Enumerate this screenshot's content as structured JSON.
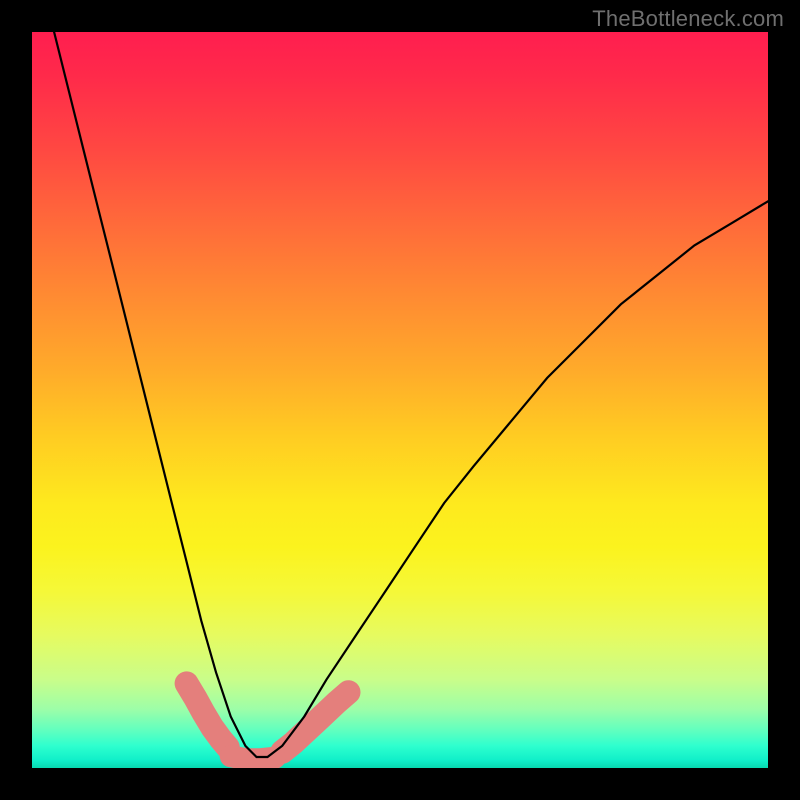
{
  "watermark": "TheBottleneck.com",
  "colors": {
    "frame": "#000000",
    "curve": "#000000",
    "salmon_band": "#e47f7c",
    "gradient_top": "#ff1e4f",
    "gradient_bottom": "#08d8b0"
  },
  "chart_data": {
    "type": "line",
    "title": "",
    "xlabel": "",
    "ylabel": "",
    "xlim": [
      0,
      100
    ],
    "ylim": [
      0,
      100
    ],
    "grid": false,
    "legend": false,
    "series": [
      {
        "name": "bottleneck-curve",
        "x": [
          3,
          5,
          7,
          9,
          11,
          13,
          15,
          17,
          19,
          21,
          23,
          25,
          27,
          29,
          30.5,
          32,
          34,
          37,
          40,
          44,
          48,
          52,
          56,
          60,
          65,
          70,
          75,
          80,
          85,
          90,
          95,
          100
        ],
        "y": [
          100,
          92,
          84,
          76,
          68,
          60,
          52,
          44,
          36,
          28,
          20,
          13,
          7,
          3,
          1.5,
          1.5,
          3,
          7,
          12,
          18,
          24,
          30,
          36,
          41,
          47,
          53,
          58,
          63,
          67,
          71,
          74,
          77
        ]
      },
      {
        "name": "salmon-band-left",
        "x": [
          21.0,
          22.2,
          23.3,
          24.5,
          25.6,
          26.6
        ],
        "y": [
          11.5,
          9.5,
          7.5,
          5.5,
          4.0,
          2.8
        ]
      },
      {
        "name": "salmon-band-right",
        "x": [
          34.0,
          35.5,
          37.0,
          38.5,
          40.0,
          41.5,
          43.0
        ],
        "y": [
          2.2,
          3.4,
          4.8,
          6.2,
          7.6,
          9.0,
          10.3
        ]
      },
      {
        "name": "salmon-band-bottom",
        "x": [
          27.0,
          29.0,
          31.0,
          33.0
        ],
        "y": [
          1.6,
          1.2,
          1.2,
          1.4
        ]
      }
    ]
  }
}
